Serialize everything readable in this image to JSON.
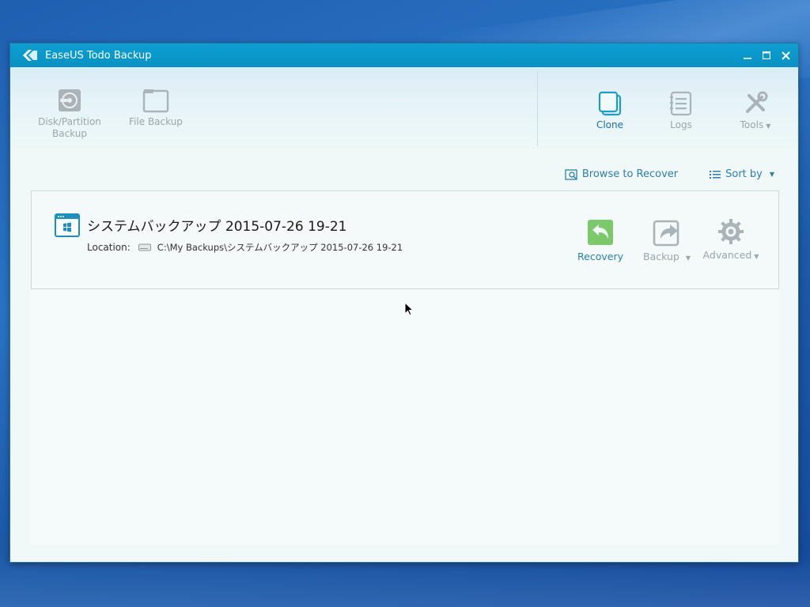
{
  "window": {
    "title": "EaseUS Todo Backup",
    "controls": {
      "minimize": "minimize-icon",
      "maximize": "maximize-icon",
      "close": "close-icon"
    }
  },
  "toolbar": {
    "disk_partition_backup": "Disk/Partition\nBackup",
    "file_backup": "File Backup",
    "clone": "Clone",
    "logs": "Logs",
    "tools": "Tools"
  },
  "actions": {
    "browse_to_recover": "Browse to Recover",
    "sort_by": "Sort by"
  },
  "backup": {
    "title": "システムバックアップ 2015-07-26 19-21",
    "location_label": "Location:",
    "location_path": "C:\\My Backups\\システムバックアップ 2015-07-26 19-21",
    "recovery": "Recovery",
    "backup": "Backup",
    "advanced": "Advanced"
  },
  "colors": {
    "titlebar": "#0792c4",
    "accent_blue": "#1b6fa6",
    "recovery_green": "#7bc96a",
    "inactive_gray": "#9aa6ab"
  }
}
